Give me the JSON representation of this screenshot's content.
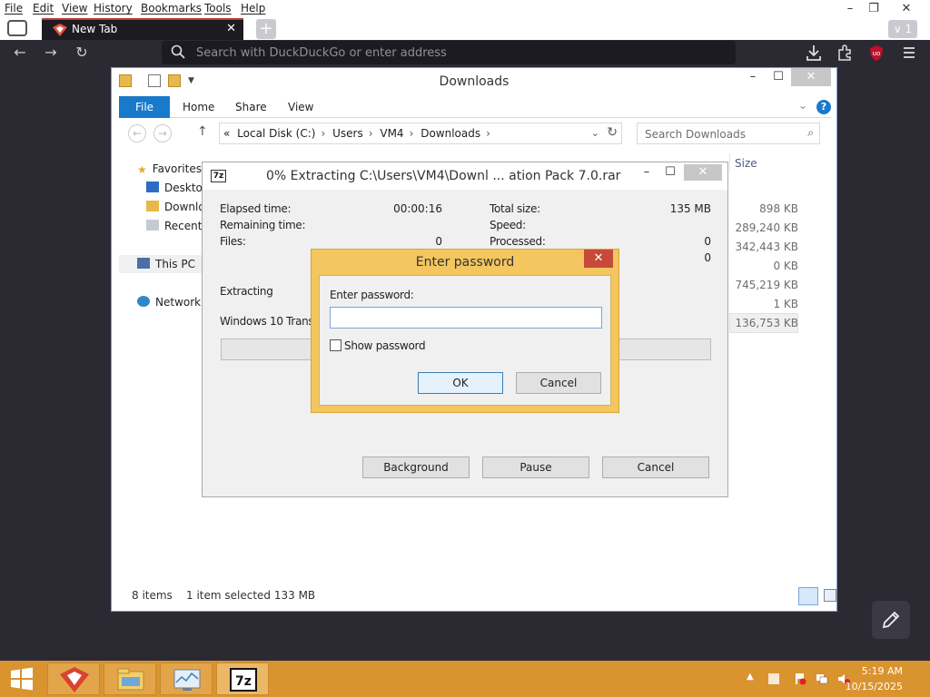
{
  "browser": {
    "menu": [
      "File",
      "Edit",
      "View",
      "History",
      "Bookmarks",
      "Tools",
      "Help"
    ],
    "window_controls": {
      "minimize": "–",
      "restore": "❐",
      "close": "✕"
    },
    "tab": {
      "title": "New Tab",
      "close": "✕"
    },
    "new_tab": "+",
    "tab_count": "∨ 1",
    "nav": {
      "back": "←",
      "forward": "→",
      "reload": "↻"
    },
    "url_placeholder": "Search with DuckDuckGo or enter address",
    "toolbar_icons": [
      "download-icon",
      "extensions-icon",
      "ublock-icon",
      "hamburger-menu-icon"
    ]
  },
  "explorer": {
    "title": "Downloads",
    "window_controls": {
      "minimize": "–",
      "maximize": "☐",
      "close": "✕"
    },
    "ribbon_tabs": [
      "File",
      "Home",
      "Share",
      "View"
    ],
    "help": "?",
    "address": {
      "prefix": "«",
      "crumbs": [
        "Local Disk (C:)",
        "Users",
        "VM4",
        "Downloads"
      ]
    },
    "search_placeholder": "Search Downloads",
    "nav": {
      "favorites": "Favorites",
      "desktop": "Desktop",
      "downloads": "Downlo",
      "recent": "Recent p",
      "thispc": "This PC",
      "network": "Network"
    },
    "column_size": "Size",
    "sizes": [
      "898 KB",
      "289,240 KB",
      "342,443 KB",
      "0 KB",
      "745,219 KB",
      "1 KB",
      "136,753 KB"
    ],
    "status": {
      "items": "8 items",
      "selected": "1 item selected  133 MB"
    }
  },
  "zip": {
    "title": "0% Extracting C:\\Users\\VM4\\Downl ... ation Pack 7.0.rar",
    "icon_text": "7z",
    "window_controls": {
      "minimize": "–",
      "maximize": "☐",
      "close": "✕"
    },
    "elapsed_label": "Elapsed time:",
    "elapsed_value": "00:00:16",
    "remaining_label": "Remaining time:",
    "files_label": "Files:",
    "files_value": "0",
    "total_label": "Total size:",
    "total_value": "135 MB",
    "speed_label": "Speed:",
    "processed_label": "Processed:",
    "processed_value": "0",
    "extra_value": "0",
    "extracting_label": "Extracting",
    "current_file": "Windows 10 Transfo",
    "progress": 0,
    "buttons": {
      "background": "Background",
      "pause": "Pause",
      "cancel": "Cancel"
    }
  },
  "password_dialog": {
    "title": "Enter password",
    "close": "✕",
    "label": "Enter password:",
    "value": "",
    "show_password": "Show password",
    "ok": "OK",
    "cancel": "Cancel"
  },
  "taskbar": {
    "time": "5:19 AM",
    "date": "10/15/2025",
    "apps": [
      "firefox-icon",
      "file-explorer-icon",
      "task-manager-icon",
      "7zip-icon"
    ],
    "active_app_label": "7z"
  },
  "colors": {
    "taskbar": "#d9932f",
    "accent_blue": "#1979ca",
    "dialog_gold": "#f3c65f",
    "close_red": "#c7493a"
  }
}
